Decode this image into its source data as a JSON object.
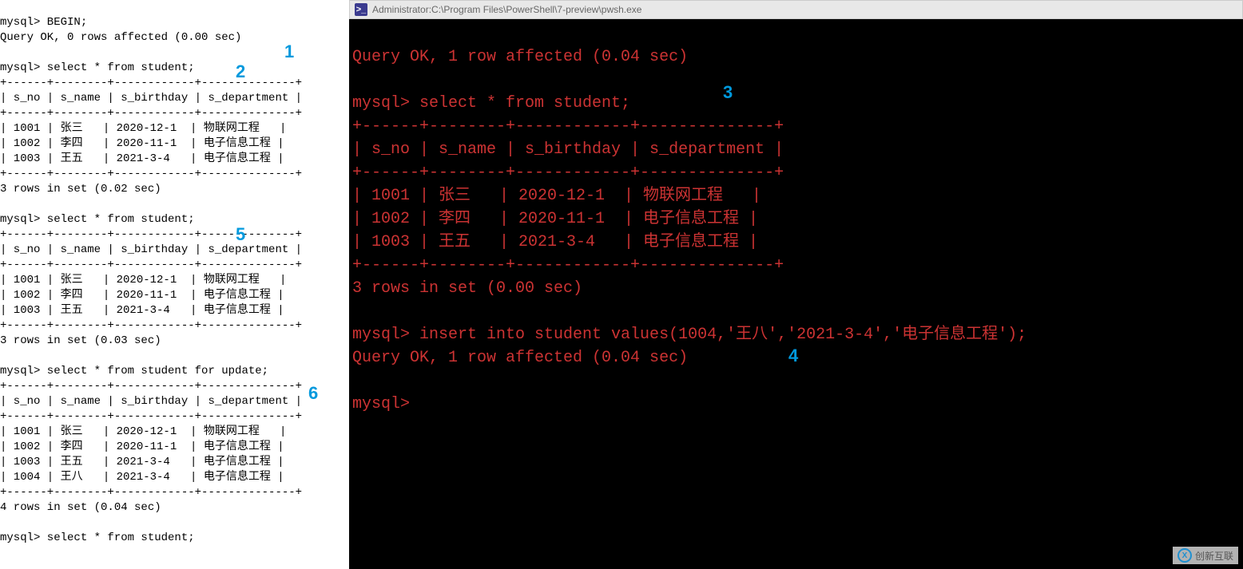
{
  "left": {
    "line_begin": "mysql> BEGIN;",
    "line_begin_ok": "Query OK, 0 rows affected (0.00 sec)",
    "select_2": "mysql> select * from student;",
    "tbl_border": "+------+--------+------------+--------------+",
    "tbl_header": "| s_no | s_name | s_birthday | s_department |",
    "rows_a": [
      "| 1001 | 张三   | 2020-12-1  | 物联网工程   |",
      "| 1002 | 李四   | 2020-11-1  | 电子信息工程 |",
      "| 1003 | 王五   | 2021-3-4   | 电子信息工程 |"
    ],
    "result_a": "3 rows in set (0.02 sec)",
    "select_5": "mysql> select * from student;",
    "result_b": "3 rows in set (0.03 sec)",
    "select_6": "mysql> select * from student for update;",
    "rows_c_extra": "| 1004 | 王八   | 2021-3-4   | 电子信息工程 |",
    "result_c": "4 rows in set (0.04 sec)",
    "next_prompt": "mysql> select * from student;"
  },
  "right": {
    "title_prefix": "Administrator: ",
    "title_path": "C:\\Program Files\\PowerShell\\7-preview\\pwsh.exe",
    "line_ok1": "Query OK, 1 row affected (0.04 sec)",
    "select_3": "mysql> select * from student;",
    "tbl_border": "+------+--------+------------+--------------+",
    "tbl_header": "| s_no | s_name | s_birthday | s_department |",
    "rows": [
      "| 1001 | 张三   | 2020-12-1  | 物联网工程   |",
      "| 1002 | 李四   | 2020-11-1  | 电子信息工程 |",
      "| 1003 | 王五   | 2021-3-4   | 电子信息工程 |"
    ],
    "result": "3 rows in set (0.00 sec)",
    "insert": "mysql> insert into student values(1004,'王八','2021-3-4','电子信息工程');",
    "insert_ok": "Query OK, 1 row affected (0.04 sec)",
    "prompt": "mysql> "
  },
  "annotations": {
    "a1": "1",
    "a2": "2",
    "a3": "3",
    "a4": "4",
    "a5": "5",
    "a6": "6"
  },
  "watermark": "创新互联"
}
